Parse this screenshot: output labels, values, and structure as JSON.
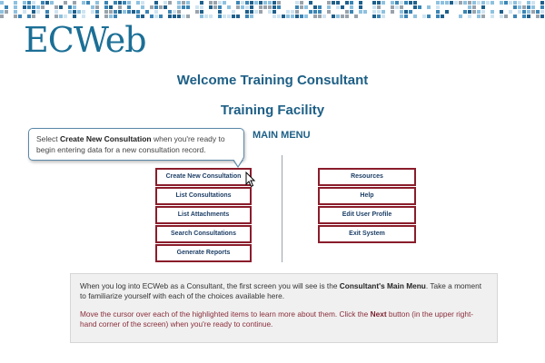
{
  "brand": {
    "logo_text": "ECWeb",
    "mosaic_colors": [
      "#1f5f8b",
      "#3b85b5",
      "#8ec1df",
      "#cfe4f1",
      "#9aa3ab",
      "#ffffff"
    ]
  },
  "header": {
    "welcome": "Welcome Training Consultant",
    "facility": "Training Facility",
    "menu_title": "MAIN MENU"
  },
  "tooltip": {
    "pre": "Select ",
    "bold": "Create New Consultation",
    "post": " when you're ready to begin entering data for a new consultation record."
  },
  "menu": {
    "left": [
      "Create New Consultation",
      "List Consultations",
      "List Attachments",
      "Search Consultations",
      "Generate Reports"
    ],
    "right": [
      "Resources",
      "Help",
      "Edit User Profile",
      "Exit System"
    ]
  },
  "info": {
    "line1_pre": "When you log into ECWeb as a Consultant, the first screen you will see is the ",
    "line1_bold": "Consultant's Main Menu",
    "line1_post": ". Take a moment to familiarize yourself with each of the choices available here.",
    "hint_pre": "Move the cursor over each of the highlighted items to learn more about them. Click the ",
    "hint_bold": "Next",
    "hint_post": " button (in the upper right-hand corner of the screen) when you're ready to continue."
  },
  "colors": {
    "brand_blue": "#1b6f96",
    "heading_blue": "#1d5f86",
    "button_border": "#8a1d2b",
    "hint_text": "#8a2d3a"
  }
}
